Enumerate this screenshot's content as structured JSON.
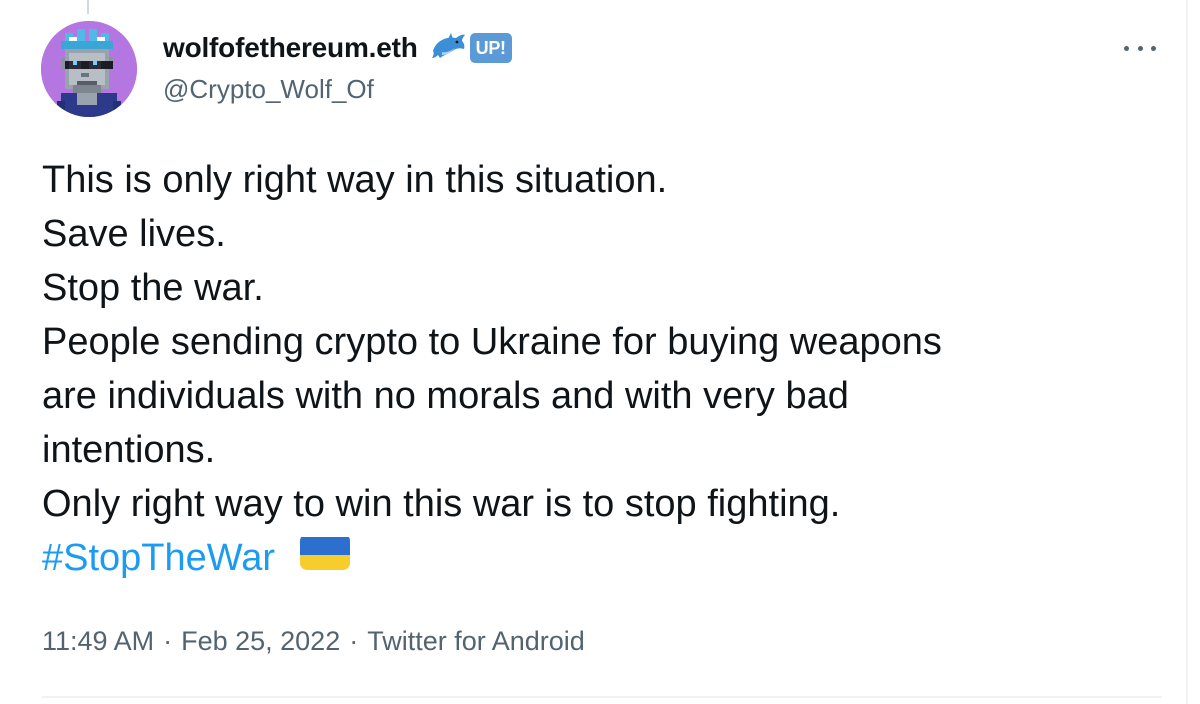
{
  "author": {
    "display_name": "wolfofethereum.eth",
    "handle": "@Crypto_Wolf_Of",
    "badge_label": "UP!",
    "avatar_icon": "pixel-wolf-avatar-icon",
    "name_emoji_icon": "dolphin-icon"
  },
  "menu": {
    "more_icon": "more-options-icon"
  },
  "tweet": {
    "lines": [
      "This is only right way in this situation.",
      "Save lives.",
      "Stop the war.",
      "People sending crypto to Ukraine for buying weapons",
      "are individuals with no morals and with very bad",
      "intentions.",
      "Only right way to win this war is to stop fighting."
    ],
    "hashtag": "#StopTheWar",
    "hashtag_emoji": "ukraine-flag-icon"
  },
  "meta": {
    "time": "11:49 AM",
    "separator": "·",
    "date": "Feb 25, 2022",
    "source": "Twitter for Android"
  },
  "colors": {
    "link": "#1d9bf0",
    "secondary_text": "#536471",
    "primary_text": "#0f1419",
    "badge": "#5b9ad6",
    "flag_blue": "#2d6fcf",
    "flag_yellow": "#f7cd2e"
  }
}
